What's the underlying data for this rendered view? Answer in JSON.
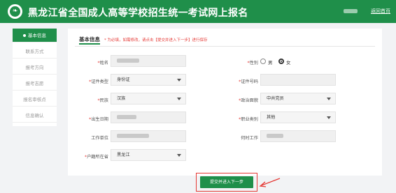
{
  "header": {
    "title": "黑龙江省全国成人高等学校招生统一考试网上报名",
    "home_link": "返回首页",
    "brand_color": "#1f8f4a"
  },
  "sidebar": {
    "items": [
      {
        "label": "基本信息",
        "active": true
      },
      {
        "label": "联系方式",
        "active": false
      },
      {
        "label": "报考方向",
        "active": false
      },
      {
        "label": "报考志愿",
        "active": false
      },
      {
        "label": "报名审核点",
        "active": false
      },
      {
        "label": "信息确认",
        "active": false
      }
    ]
  },
  "panel": {
    "title": "基本信息",
    "note": "* 为必填，如需修改，请点击【提交并进入下一步】进行保存",
    "fields": {
      "name": {
        "label": "姓名",
        "required": true
      },
      "gender": {
        "label": "性别",
        "required": true,
        "options": [
          "男",
          "女"
        ],
        "selected": "女"
      },
      "id_type": {
        "label": "证件类型",
        "required": true,
        "value": "身份证"
      },
      "id_number": {
        "label": "证件号码",
        "required": true
      },
      "ethnicity": {
        "label": "民族",
        "required": true,
        "value": "汉族"
      },
      "political_status": {
        "label": "政治面貌",
        "required": true,
        "value": "中共党员"
      },
      "birth_date": {
        "label": "出生日期",
        "required": true
      },
      "occupation": {
        "label": "职业类别",
        "required": true,
        "value": "其他"
      },
      "work_unit": {
        "label": "工作单位",
        "required": false
      },
      "work_start": {
        "label": "何时工作",
        "required": false
      },
      "hukou_province": {
        "label": "户籍所在省",
        "required": true,
        "value": "黑龙江"
      }
    }
  },
  "actions": {
    "submit_label": "提交并进入下一步"
  }
}
